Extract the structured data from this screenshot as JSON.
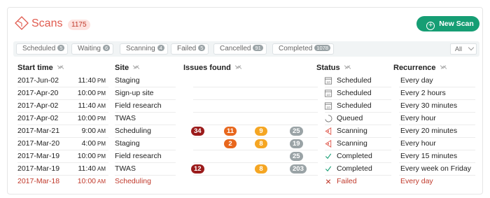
{
  "header": {
    "title": "Scans",
    "count": "1175",
    "new_scan_label": "New Scan",
    "accent": "#e05a4e",
    "button_color": "#169e74"
  },
  "filters": [
    {
      "label": "Scheduled",
      "count": "5"
    },
    {
      "label": "Waiting",
      "count": "6"
    },
    {
      "label": "Scanning",
      "count": "4"
    },
    {
      "label": "Failed",
      "count": "5"
    },
    {
      "label": "Cancelled",
      "count": "91"
    },
    {
      "label": "Completed",
      "count": "1078"
    }
  ],
  "filter_select": {
    "value": "All"
  },
  "columns": {
    "start_time": "Start time",
    "site": "Site",
    "issues": "Issues found",
    "status": "Status",
    "recurrence": "Recurrence"
  },
  "rows": [
    {
      "date": "2017-Jun-02",
      "time": "11:40",
      "ampm": "PM",
      "site": "Staging",
      "issues": {
        "critical": "",
        "high": "",
        "medium": "",
        "low": ""
      },
      "status": "Scheduled",
      "status_icon": "calendar-icon",
      "recurrence": "Every day"
    },
    {
      "date": "2017-Apr-20",
      "time": "10:00",
      "ampm": "PM",
      "site": "Sign-up site",
      "issues": {
        "critical": "",
        "high": "",
        "medium": "",
        "low": ""
      },
      "status": "Scheduled",
      "status_icon": "calendar-icon",
      "recurrence": "Every 2 hours"
    },
    {
      "date": "2017-Apr-02",
      "time": "11:40",
      "ampm": "AM",
      "site": "Field research",
      "issues": {
        "critical": "",
        "high": "",
        "medium": "",
        "low": ""
      },
      "status": "Scheduled",
      "status_icon": "calendar-icon",
      "recurrence": "Every 30 minutes"
    },
    {
      "date": "2017-Apr-02",
      "time": "10:00",
      "ampm": "PM",
      "site": "TWAS",
      "issues": {
        "critical": "",
        "high": "",
        "medium": "",
        "low": ""
      },
      "status": "Queued",
      "status_icon": "queued-icon",
      "recurrence": "Every hour"
    },
    {
      "date": "2017-Mar-21",
      "time": "9:00",
      "ampm": "AM",
      "site": "Scheduling",
      "issues": {
        "critical": "34",
        "high": "11",
        "medium": "9",
        "low": "25"
      },
      "status": "Scanning",
      "status_icon": "radar-icon",
      "recurrence": "Every 20 minutes"
    },
    {
      "date": "2017-Mar-20",
      "time": "4:00",
      "ampm": "PM",
      "site": "Staging",
      "issues": {
        "critical": "",
        "high": "2",
        "medium": "8",
        "low": "19"
      },
      "status": "Scanning",
      "status_icon": "radar-icon",
      "recurrence": "Every hour"
    },
    {
      "date": "2017-Mar-19",
      "time": "10:00",
      "ampm": "PM",
      "site": "Field research",
      "issues": {
        "critical": "",
        "high": "",
        "medium": "",
        "low": "25"
      },
      "status": "Completed",
      "status_icon": "check-icon",
      "recurrence": "Every 15 minutes"
    },
    {
      "date": "2017-Mar-19",
      "time": "11:40",
      "ampm": "AM",
      "site": "TWAS",
      "issues": {
        "critical": "12",
        "high": "",
        "medium": "8",
        "low": "203"
      },
      "status": "Completed",
      "status_icon": "check-icon",
      "recurrence": "Every week on Friday"
    },
    {
      "date": "2017-Mar-18",
      "time": "10:00",
      "ampm": "AM",
      "site": "Scheduling",
      "issues": {
        "critical": "",
        "high": "",
        "medium": "",
        "low": ""
      },
      "status": "Failed",
      "status_icon": "x-icon",
      "recurrence": "Every day"
    }
  ],
  "colors": {
    "critical": "#9b1b1b",
    "high": "#e8671d",
    "medium": "#f5a623",
    "low": "#9aa3a6",
    "failed": "#c0392b",
    "completed": "#169e74"
  }
}
